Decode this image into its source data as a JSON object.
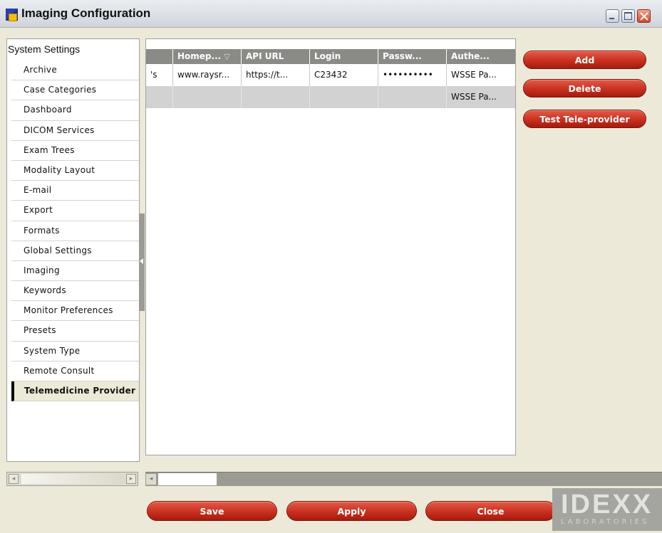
{
  "window": {
    "title": "Imaging Configuration",
    "app_icon": "app-icon",
    "controls": [
      "minimize-icon",
      "maximize-icon",
      "close-icon"
    ]
  },
  "sidebar": {
    "section_title": "System Settings",
    "items": [
      {
        "label": "Archive"
      },
      {
        "label": "Case Categories"
      },
      {
        "label": "Dashboard"
      },
      {
        "label": "DICOM Services"
      },
      {
        "label": "Exam Trees"
      },
      {
        "label": "Modality Layout"
      },
      {
        "label": "E-mail"
      },
      {
        "label": "Export"
      },
      {
        "label": "Formats"
      },
      {
        "label": "Global Settings"
      },
      {
        "label": "Imaging"
      },
      {
        "label": "Keywords"
      },
      {
        "label": "Monitor Preferences"
      },
      {
        "label": "Presets"
      },
      {
        "label": "System Type"
      },
      {
        "label": "Remote Consult"
      },
      {
        "label": "Telemedicine Provider",
        "active": true
      }
    ]
  },
  "table": {
    "columns": [
      "",
      "Homep...",
      "API URL",
      "Login",
      "Passw...",
      "Authe..."
    ],
    "sorted_column_icon": "sort-descending-icon",
    "rows": [
      [
        "'s",
        "www.raysr...",
        "https://t...",
        "C23432",
        "••••••••••",
        "WSSE Pa..."
      ],
      [
        "",
        "",
        "",
        "",
        "",
        "WSSE Pa..."
      ]
    ],
    "selected_row": 1
  },
  "actions": {
    "add": "Add",
    "delete": "Delete",
    "test": "Test Tele-provider"
  },
  "footer": {
    "save": "Save",
    "apply": "Apply",
    "close": "Close",
    "logo": {
      "word": "IDEXX",
      "sub": "LABORATORIES"
    }
  },
  "colors": {
    "button_red": "#c9301f",
    "header_gray": "#8a8a86",
    "window_bg": "#ece9d8",
    "selected_row": "#d2d2d2"
  }
}
